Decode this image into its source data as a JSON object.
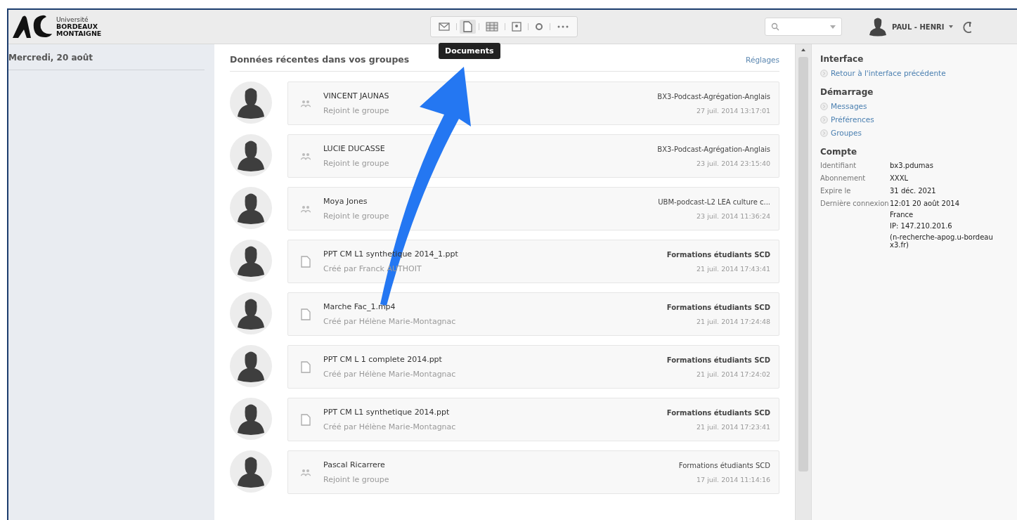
{
  "header": {
    "logo_lines": [
      "Université",
      "BORDEAUX",
      "MONTAIGNE"
    ],
    "toolbar": [
      {
        "kind": "mail",
        "selected": false
      },
      {
        "kind": "document",
        "selected": true
      },
      {
        "kind": "calendar",
        "selected": false
      },
      {
        "kind": "contact",
        "selected": false
      },
      {
        "kind": "settings",
        "selected": false
      },
      {
        "kind": "more",
        "selected": false
      }
    ],
    "tooltip": "Documents",
    "user": "PAUL - HENRI"
  },
  "sidebar": {
    "date": "Mercredi, 20 août"
  },
  "feed": {
    "title": "Données récentes dans vos groupes",
    "settings_link": "Réglages",
    "items": [
      {
        "kind": "member",
        "title": "VINCENT JAUNAS",
        "subtitle": "Rejoint le groupe",
        "group": "BX3-Podcast-Agrégation-Anglais",
        "time": "27 juil. 2014 13:17:01"
      },
      {
        "kind": "member",
        "title": "LUCIE DUCASSE",
        "subtitle": "Rejoint le groupe",
        "group": "BX3-Podcast-Agrégation-Anglais",
        "time": "23 juil. 2014 23:15:40"
      },
      {
        "kind": "member",
        "title": "Moya Jones",
        "subtitle": "Rejoint le groupe",
        "group": "UBM-podcast-L2 LEA culture c...",
        "time": "23 juil. 2014 11:36:24"
      },
      {
        "kind": "document",
        "title": "PPT CM L1 synthetique 2014_1.ppt",
        "subtitle": "Créé par Franck AUTHOIT",
        "group": "Formations étudiants SCD",
        "time": "21 juil. 2014 17:43:41"
      },
      {
        "kind": "document",
        "title": "Marche Fac_1.mp4",
        "subtitle": "Créé par Hélène Marie-Montagnac",
        "group": "Formations étudiants SCD",
        "time": "21 juil. 2014 17:24:48"
      },
      {
        "kind": "document",
        "title": "PPT CM L 1 complete 2014.ppt",
        "subtitle": "Créé par Hélène Marie-Montagnac",
        "group": "Formations étudiants SCD",
        "time": "21 juil. 2014 17:24:02"
      },
      {
        "kind": "document",
        "title": "PPT CM L1 synthetique 2014.ppt",
        "subtitle": "Créé par Hélène Marie-Montagnac",
        "group": "Formations étudiants SCD",
        "time": "21 juil. 2014 17:23:41"
      },
      {
        "kind": "member",
        "title": "Pascal Ricarrere",
        "subtitle": "Rejoint le groupe",
        "group": "Formations étudiants SCD",
        "time": "17 juil. 2014 11:14:16"
      }
    ]
  },
  "panel": {
    "sections": [
      {
        "title": "Interface",
        "links": [
          "Retour à l'interface précédente"
        ]
      },
      {
        "title": "Démarrage",
        "links": [
          "Messages",
          "Préférences",
          "Groupes"
        ]
      }
    ],
    "account": {
      "title": "Compte",
      "rows": [
        {
          "label": "Identifiant",
          "lines": [
            "bx3.pdumas"
          ]
        },
        {
          "label": "Abonnement",
          "lines": [
            "XXXL"
          ]
        },
        {
          "label": "Expire le",
          "lines": [
            "31 déc. 2021"
          ]
        },
        {
          "label": "Dernière connexion",
          "lines": [
            "12:01 20 août 2014",
            "France",
            "IP: 147.210.201.6",
            "(n-recherche-apog.u-bordeaux3.fr)"
          ]
        }
      ]
    }
  }
}
